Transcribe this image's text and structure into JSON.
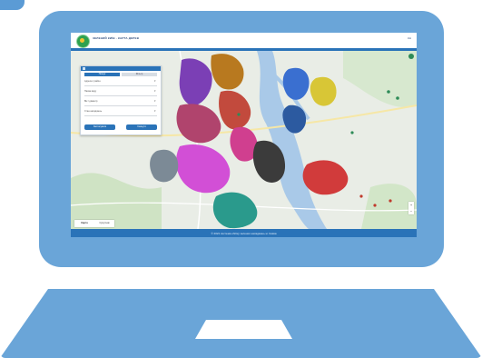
{
  "header": {
    "title": "ЗЕЛЕНИЙ КИЇВ · КАРТА ДЕРЕВ",
    "lang": "UA"
  },
  "panel": {
    "tabs": [
      "Пошук",
      "Фільтр"
    ],
    "fields": [
      {
        "label": "Адреса / район",
        "chevron": "▾"
      },
      {
        "label": "Назва виду",
        "chevron": "▾"
      },
      {
        "label": "Вік / діаметр",
        "chevron": "▾"
      },
      {
        "label": "Стан насаджень",
        "chevron": "▾"
      }
    ],
    "buttons": [
      "Застосувати",
      "Скинути"
    ]
  },
  "map": {
    "switch": [
      "Карта",
      "Супутник"
    ],
    "zoom": [
      "+",
      "−"
    ]
  },
  "footer": {
    "text": "© 2021 система обліку зелених насаджень м. Києва"
  },
  "colors": {
    "laptop": "#6aa5d8",
    "header_bar": "#2a73b8"
  }
}
